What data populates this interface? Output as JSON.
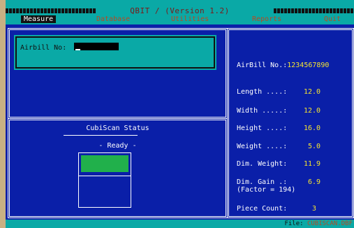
{
  "app": {
    "title": "QBIT  /  (Version 1.2)"
  },
  "menu": {
    "items": [
      {
        "label": "Measure",
        "active": true
      },
      {
        "label": "Database",
        "active": false
      },
      {
        "label": "Utilities",
        "active": false
      },
      {
        "label": "Reports",
        "active": false
      },
      {
        "label": "Quit",
        "active": false
      }
    ]
  },
  "airbill_entry": {
    "label": "Airbill No:",
    "value": ""
  },
  "status": {
    "title": "CubiScan Status",
    "state": "- Ready -",
    "light_color": "#21b04b"
  },
  "results": {
    "airbill": {
      "label": "AirBill No.:",
      "value": "1234567890"
    },
    "length": {
      "label": "Length ....:",
      "value": "12.0"
    },
    "width": {
      "label": "Width .....:",
      "value": "12.0"
    },
    "height": {
      "label": "Height ....:",
      "value": "16.0"
    },
    "weight": {
      "label": "Weight ....:",
      "value": "5.0"
    },
    "dim_weight": {
      "label": "Dim. Weight:",
      "value": "11.9"
    },
    "dim_gain": {
      "label": "Dim. Gain .:",
      "value": "6.9",
      "factor": "(Factor = 194)"
    },
    "piece_count": {
      "label": "Piece Count:",
      "value": "3"
    }
  },
  "footer": {
    "file_label": "File:",
    "file_name": "CUBISCAN.DBF"
  },
  "colors": {
    "screen_bg": "#0a1fa8",
    "bar_bg": "#0aa9a6",
    "value_yellow": "#f5e431",
    "menu_text": "#b74a22"
  }
}
